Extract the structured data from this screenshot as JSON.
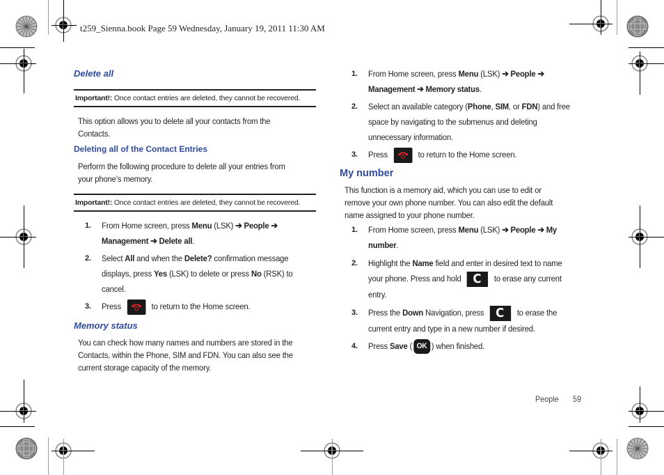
{
  "header": {
    "print_line": "t259_Sienna.book  Page 59  Wednesday, January 19, 2011  11:30 AM"
  },
  "left_column": {
    "delete_all": {
      "heading": "Delete all",
      "note_label": "Important!:",
      "note_text": " Once contact entries are deleted, they cannot be recovered.",
      "intro_line1": "This option allows you to delete all your contacts from the",
      "intro_line2": "Contacts."
    },
    "deleting_entries": {
      "heading": "Deleting all of the Contact Entries",
      "intro_line1": "Perform the following procedure to delete all your entries from",
      "intro_line2": "your phone’s memory.",
      "note_label": "Important!:",
      "note_text": " Once contact entries are deleted, they cannot be recovered.",
      "steps": [
        {
          "num": "1.",
          "line1": [
            {
              "t": "From Home screen, press "
            },
            {
              "b": "Menu"
            },
            {
              "t": " (LSK) "
            },
            {
              "b": "➔ People ➔"
            }
          ],
          "line2": [
            {
              "b": "Management  ➔ Delete all"
            },
            {
              "t": "."
            }
          ]
        },
        {
          "num": "2.",
          "line1": [
            {
              "t": "Select "
            },
            {
              "b": "All"
            },
            {
              "t": " and when the "
            },
            {
              "b": "Delete?"
            },
            {
              "t": " confirmation message"
            }
          ],
          "line2": [
            {
              "t": "displays, press "
            },
            {
              "b": "Yes"
            },
            {
              "t": " (LSK) to delete or press "
            },
            {
              "b": "No"
            },
            {
              "t": " (RSK) to"
            }
          ],
          "line3": [
            {
              "t": "cancel."
            }
          ]
        },
        {
          "num": "3.",
          "before_icon": "Press",
          "icon": "end-key-icon",
          "after_icon": "to return to the Home screen."
        }
      ]
    },
    "memory_status": {
      "heading": "Memory status",
      "line1": "You can check how many names and numbers are stored in the",
      "line2": "Contacts, within the Phone, SIM and FDN. You can also see the",
      "line3": "current storage capacity of the memory."
    }
  },
  "right_column": {
    "memory_steps": [
      {
        "num": "1.",
        "line1": [
          {
            "t": "From Home screen, press "
          },
          {
            "b": "Menu"
          },
          {
            "t": " (LSK) "
          },
          {
            "b": "➔ People ➔"
          }
        ],
        "line2": [
          {
            "b": "Management  ➔ Memory status"
          },
          {
            "t": "."
          }
        ]
      },
      {
        "num": "2.",
        "line1": [
          {
            "t": "Select an available category ("
          },
          {
            "b": "Phone"
          },
          {
            "t": ", "
          },
          {
            "b": "SIM"
          },
          {
            "t": ", or "
          },
          {
            "b": "FDN"
          },
          {
            "t": ") and free"
          }
        ],
        "line2": [
          {
            "t": "space by navigating to the submenus and deleting"
          }
        ],
        "line3": [
          {
            "t": "unnecessary information."
          }
        ]
      },
      {
        "num": "3.",
        "before_icon": "Press",
        "icon": "end-key-icon",
        "after_icon": "to return to the Home screen."
      }
    ],
    "my_number": {
      "heading": "My number",
      "line1": "This function is a memory aid, which you can use to edit or",
      "line2": "remove your own phone number. You can also edit the default",
      "line3": "name assigned to your phone number.",
      "steps": [
        {
          "num": "1.",
          "line1": [
            {
              "t": "From Home screen, press "
            },
            {
              "b": "Menu"
            },
            {
              "t": " (LSK) "
            },
            {
              "b": "➔ People ➔ My"
            }
          ],
          "line2": [
            {
              "b": "number"
            },
            {
              "t": "."
            }
          ]
        },
        {
          "num": "2.",
          "line1": [
            {
              "t": "Highlight the "
            },
            {
              "b": "Name"
            },
            {
              "t": " field and enter in desired text to name"
            }
          ],
          "line2_before": "your phone. Press and hold",
          "line2_icon": "clear-key-icon",
          "line2_after": "to erase any current",
          "line3": [
            {
              "t": "entry."
            }
          ]
        },
        {
          "num": "3.",
          "line1_before_bold": "Press the ",
          "line1_bold": "Down",
          "line1_after": " Navigation, press",
          "line1_icon": "clear-key-icon",
          "line1_end": "to erase the",
          "line2": [
            {
              "t": "current entry and type in a new number if desired."
            }
          ]
        },
        {
          "num": "4.",
          "before": "Press ",
          "bold": "Save",
          "paren_open": " (",
          "icon": "ok-key-icon",
          "icon_label": "OK",
          "paren_close": ") when finished."
        }
      ]
    }
  },
  "keys": {
    "clear_label": "C",
    "ok_label": "OK"
  },
  "footer": {
    "section": "People",
    "page_number": "59"
  },
  "colors": {
    "heading_blue": "#2f4a9e",
    "text": "#231f20",
    "key_bg": "#1a1a1a",
    "end_key_red": "#e0262b"
  }
}
